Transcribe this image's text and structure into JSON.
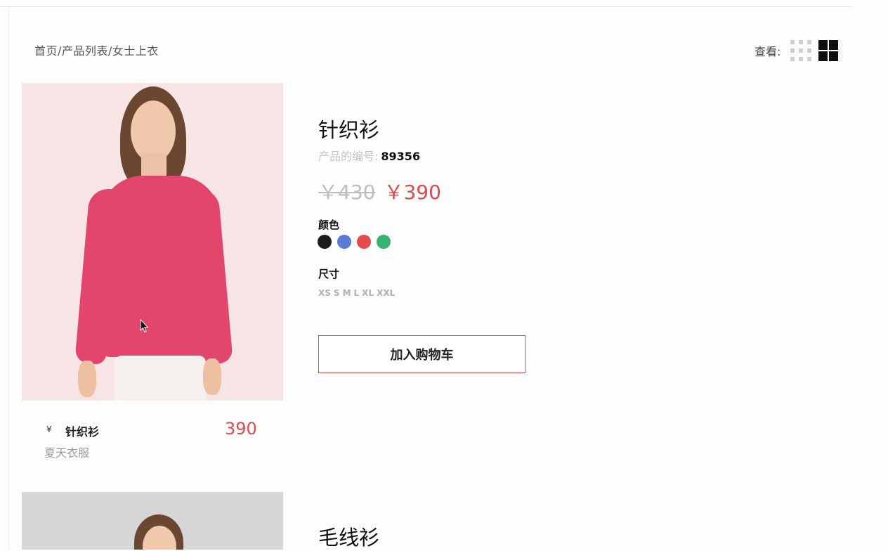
{
  "breadcrumb": "首页/产品列表/女士上衣",
  "view": {
    "label": "查看:",
    "options": [
      "grid-small-icon",
      "grid-large-icon"
    ]
  },
  "products": [
    {
      "name": "针织衫",
      "code_label": "产品的编号:",
      "code": "89356",
      "old_price": "￥430",
      "new_price": "￥390",
      "color_label": "颜色",
      "colors": [
        "#1c1c1c",
        "#5b7bd6",
        "#e64a4a",
        "#37b36f"
      ],
      "size_label": "尺寸",
      "sizes": [
        "XS",
        "S",
        "M",
        "L",
        "XL",
        "XXL"
      ],
      "cart_button": "加入购物车",
      "card": {
        "currency": "¥",
        "name": "针织衫",
        "price": "390",
        "subtitle": "夏天衣服"
      }
    },
    {
      "name": "毛线衫"
    }
  ],
  "accent_color": "#e0494f"
}
